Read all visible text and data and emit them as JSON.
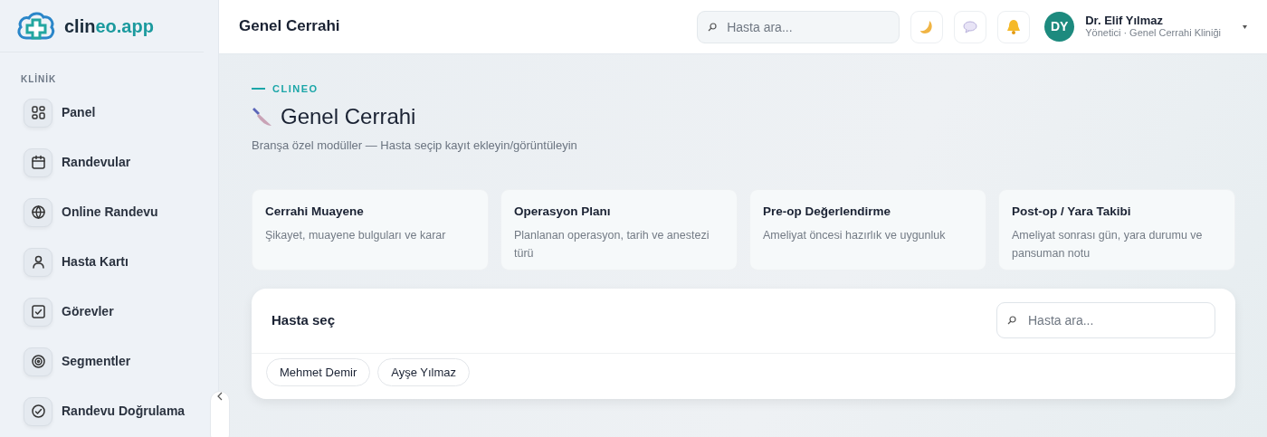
{
  "brand": {
    "name_start": "clin",
    "name_accent": "eo",
    "name_end": ".app"
  },
  "sidebar": {
    "section": "KLİNİK",
    "items": [
      {
        "label": "Panel",
        "kind": "grid"
      },
      {
        "label": "Randevular",
        "kind": "calendar"
      },
      {
        "label": "Online Randevu",
        "kind": "globe"
      },
      {
        "label": "Hasta Kartı",
        "kind": "person"
      },
      {
        "label": "Görevler",
        "kind": "check"
      },
      {
        "label": "Segmentler",
        "kind": "target"
      },
      {
        "label": "Randevu Doğrulama",
        "kind": "circlecheck"
      }
    ]
  },
  "header": {
    "title": "Genel Cerrahi",
    "search": {
      "placeholder": "Hasta ara..."
    },
    "user": {
      "initials": "DY",
      "name": "Dr. Elif Yılmaz",
      "role": "Yönetici · Genel Cerrahi Kliniği"
    }
  },
  "page": {
    "eyebrow": "CLINEO",
    "title": "Genel Cerrahi",
    "subtitle": "Branşa özel modüller — Hasta seçip kayıt ekleyin/görüntüleyin"
  },
  "modules": [
    {
      "title": "Cerrahi Muayene",
      "description": "Şikayet, muayene bulguları ve karar"
    },
    {
      "title": "Operasyon Planı",
      "description": "Planlanan operasyon, tarih ve anestezi türü"
    },
    {
      "title": "Pre-op Değerlendirme",
      "description": "Ameliyat öncesi hazırlık ve uygunluk"
    },
    {
      "title": "Post-op / Yara Takibi",
      "description": "Ameliyat sonrası gün, yara durumu ve pansuman notu"
    }
  ],
  "patient_picker": {
    "title": "Hasta seç",
    "search": {
      "placeholder": "Hasta ara..."
    },
    "patients": [
      "Mehmet Demir",
      "Ayşe Yılmaz"
    ]
  }
}
